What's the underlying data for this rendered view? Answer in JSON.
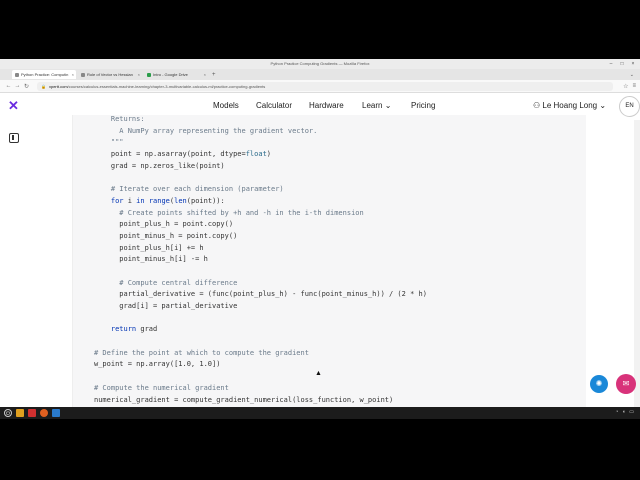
{
  "window": {
    "title": "Python Practice Computing Gradients — Mozilla Firefox"
  },
  "tabs": [
    {
      "label": "Python Practice: Computin",
      "active": true
    },
    {
      "label": "Role of Vector vs Hessian",
      "active": false
    },
    {
      "label": "Intro - Google Drive",
      "active": false
    }
  ],
  "url": {
    "host": "xpertt.com",
    "path": "/courses/calculus-essentials-machine-learning/chapter-3-multivariable-calculus-ml/practice-computing-gradients"
  },
  "site": {
    "nav": [
      "Models",
      "Calculator",
      "Hardware",
      "Learn",
      "Pricing"
    ],
    "user_name": "Le Hoang Long",
    "lang": "EN"
  },
  "code_lines": [
    "    Returns:",
    "      A NumPy array representing the gradient vector.",
    "    \"\"\"",
    "    point = np.asarray(point, dtype=float)",
    "    grad = np.zeros_like(point)",
    "",
    "    # Iterate over each dimension (parameter)",
    "    for i in range(len(point)):",
    "      # Create points shifted by +h and -h in the i-th dimension",
    "      point_plus_h = point.copy()",
    "      point_minus_h = point.copy()",
    "      point_plus_h[i] += h",
    "      point_minus_h[i] -= h",
    "",
    "      # Compute central difference",
    "      partial_derivative = (func(point_plus_h) - func(point_minus_h)) / (2 * h)",
    "      grad[i] = partial_derivative",
    "",
    "    return grad",
    "",
    "# Define the point at which to compute the gradient",
    "w_point = np.array([1.0, 1.0])",
    "",
    "# Compute the numerical gradient",
    "numerical_gradient = compute_gradient_numerical(loss_function, w_point)"
  ],
  "colors": {
    "brand": "#6a2be0",
    "keyword": "#0033b3",
    "comment": "#6a7a8a",
    "fab_blue": "#1a88d8",
    "fab_pink": "#d8327a"
  },
  "icons": {
    "logo": "x-logo-icon",
    "sidebar": "sidebar-toggle-icon",
    "fab1": "settings-bot-icon",
    "fab2": "chat-icon"
  }
}
